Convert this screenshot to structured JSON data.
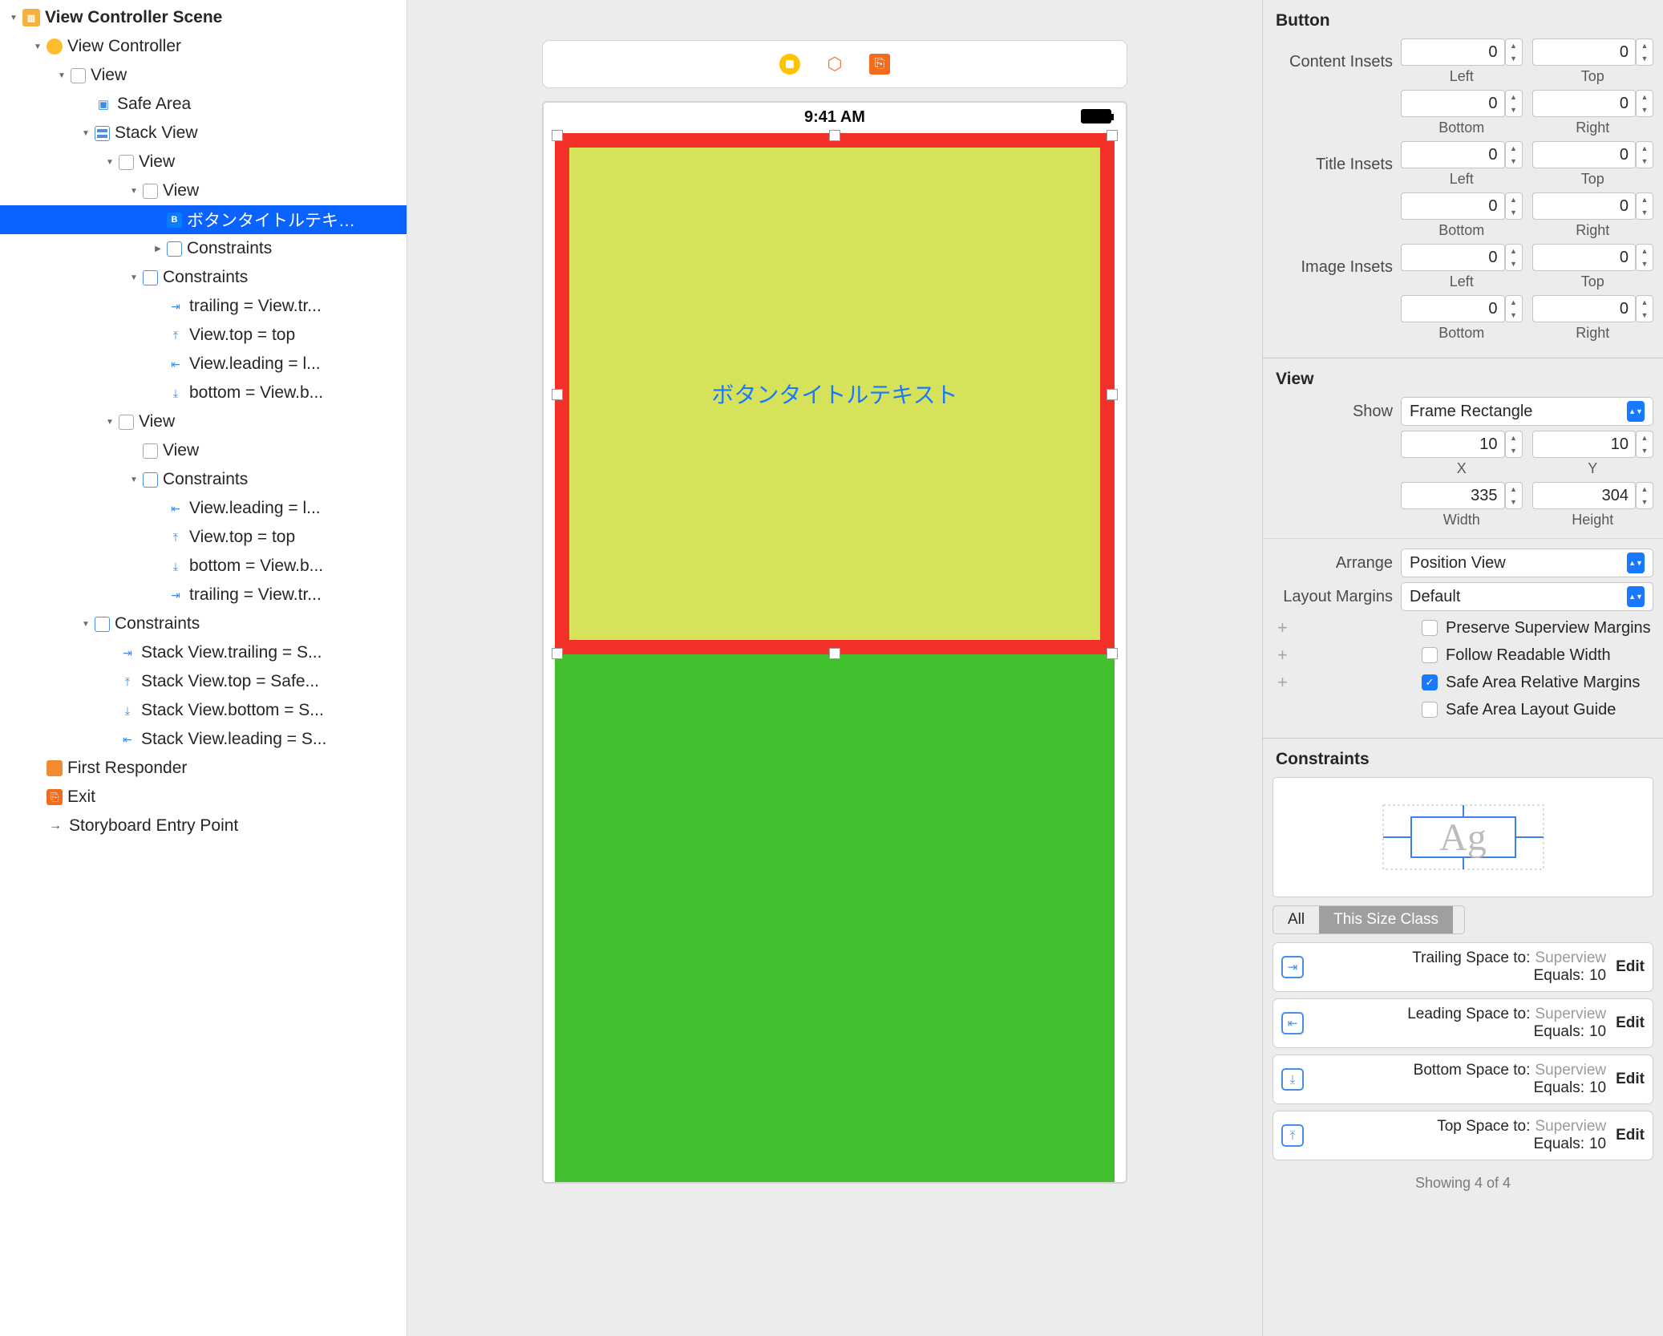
{
  "outline": {
    "scene": "View Controller Scene",
    "vc": "View Controller",
    "rootView": "View",
    "safeArea": "Safe Area",
    "stackView": "Stack View",
    "view1": "View",
    "view1a": "View",
    "buttonTitle": "ボタンタイトルテキ…",
    "constraints": "Constraints",
    "c_trailing": "trailing = View.tr...",
    "c_viewtop": "View.top = top",
    "c_viewleading": "View.leading = l...",
    "c_bottom": "bottom = View.b...",
    "view2": "View",
    "view2a": "View",
    "c2_viewleading": "View.leading = l...",
    "c2_viewtop": "View.top = top",
    "c2_bottom": "bottom = View.b...",
    "c2_trailing": "trailing = View.tr...",
    "svConstraints": "Constraints",
    "svc1": "Stack View.trailing = S...",
    "svc2": "Stack View.top = Safe...",
    "svc3": "Stack View.bottom = S...",
    "svc4": "Stack View.leading = S...",
    "firstResponder": "First Responder",
    "exit": "Exit",
    "entry": "Storyboard Entry Point"
  },
  "canvas": {
    "time": "9:41 AM",
    "buttonText": "ボタンタイトルテキスト"
  },
  "inspector": {
    "buttonSection": "Button",
    "contentInsets": "Content Insets",
    "titleInsets": "Title Insets",
    "imageInsets": "Image Insets",
    "left": "Left",
    "top": "Top",
    "bottom": "Bottom",
    "right": "Right",
    "zero": "0",
    "viewSection": "View",
    "show": "Show",
    "showValue": "Frame Rectangle",
    "x": "X",
    "y": "Y",
    "xVal": "10",
    "yVal": "10",
    "width": "Width",
    "height": "Height",
    "wVal": "335",
    "hVal": "304",
    "arrange": "Arrange",
    "arrangeValue": "Position View",
    "layoutMargins": "Layout Margins",
    "layoutMarginsValue": "Default",
    "preserve": "Preserve Superview Margins",
    "follow": "Follow Readable Width",
    "safeAreaRel": "Safe Area Relative Margins",
    "safeAreaGuide": "Safe Area Layout Guide",
    "constraintsSection": "Constraints",
    "segAll": "All",
    "segThis": "This Size Class",
    "ag": "Ag",
    "ci1k": "Trailing Space to:",
    "ci2k": "Leading Space to:",
    "ci3k": "Bottom Space to:",
    "ci4k": "Top Space to:",
    "superview": "Superview",
    "equals": "Equals:",
    "equalsVal": "10",
    "edit": "Edit",
    "showing": "Showing 4 of 4"
  }
}
